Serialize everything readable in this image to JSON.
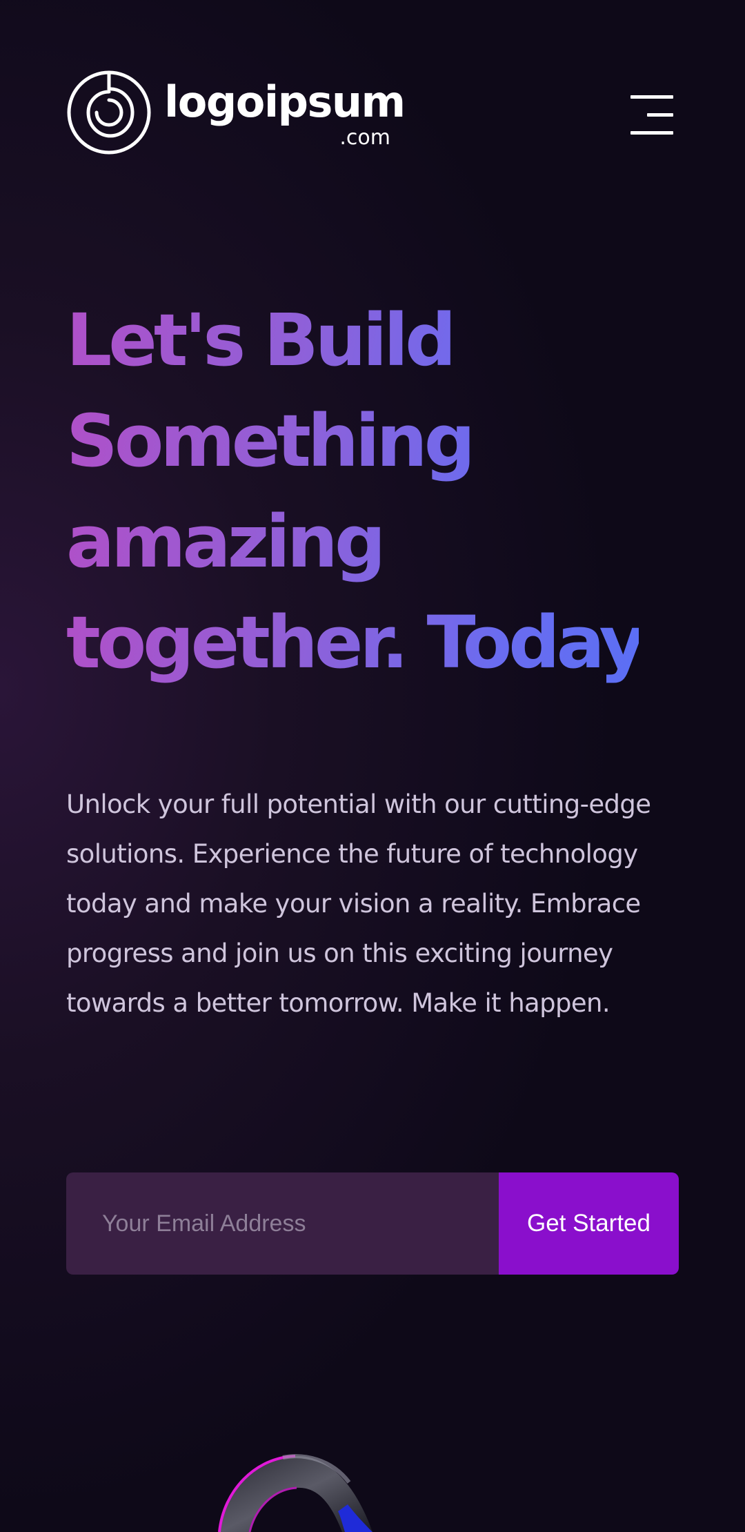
{
  "header": {
    "logo": {
      "name": "logoipsum",
      "tld": ".com",
      "icon": "spiral-logo-icon"
    },
    "menu_icon": "hamburger-menu-icon"
  },
  "hero": {
    "headline_lines": [
      "Let's Build",
      "Something",
      "amazing",
      "together. Today."
    ],
    "description": "Unlock your full potential with our cutting-edge solutions. Experience the future of technology today and make your vision a reality. Embrace progress and join us on this exciting journey towards a better tomorrow. Make it happen."
  },
  "signup": {
    "email_placeholder": "Your Email Address",
    "email_value": "",
    "button_label": "Get Started"
  },
  "colors": {
    "background": "#150d20",
    "headline_gradient_start": "#b050c8",
    "headline_gradient_end": "#5b6ff4",
    "input_background": "#3a2044",
    "button_background": "#8a0fcc",
    "body_text": "#cfc5dc"
  }
}
